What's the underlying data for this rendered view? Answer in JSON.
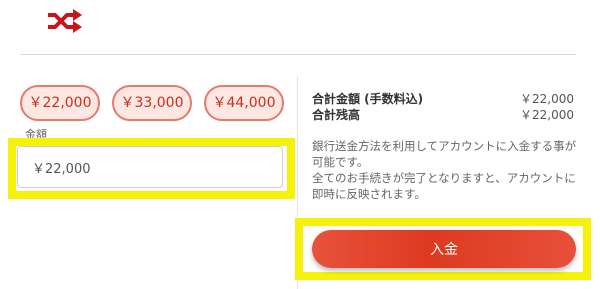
{
  "header": {
    "logo_icon": "shuffle-icon",
    "brand_color": "#c8141c"
  },
  "preset_amounts": [
    "￥22,000",
    "￥33,000",
    "￥44,000"
  ],
  "amount_field": {
    "label": "金額",
    "value": "￥22,000"
  },
  "summary": {
    "total_label": "合計金額 (手数料込)",
    "total_value": "￥22,000",
    "balance_label": "合計残高",
    "balance_value": "￥22,000"
  },
  "description": {
    "line1": "銀行送金方法を利用してアカウントに入金する事が可能です。",
    "line2": "全てのお手続きが完了となりますと、アカウントに即時に反映されます。"
  },
  "deposit_button": {
    "label": "入金"
  },
  "colors": {
    "highlight": "#f6f10b",
    "accent": "#dd3a20",
    "pill_bg": "#fde7e2"
  }
}
